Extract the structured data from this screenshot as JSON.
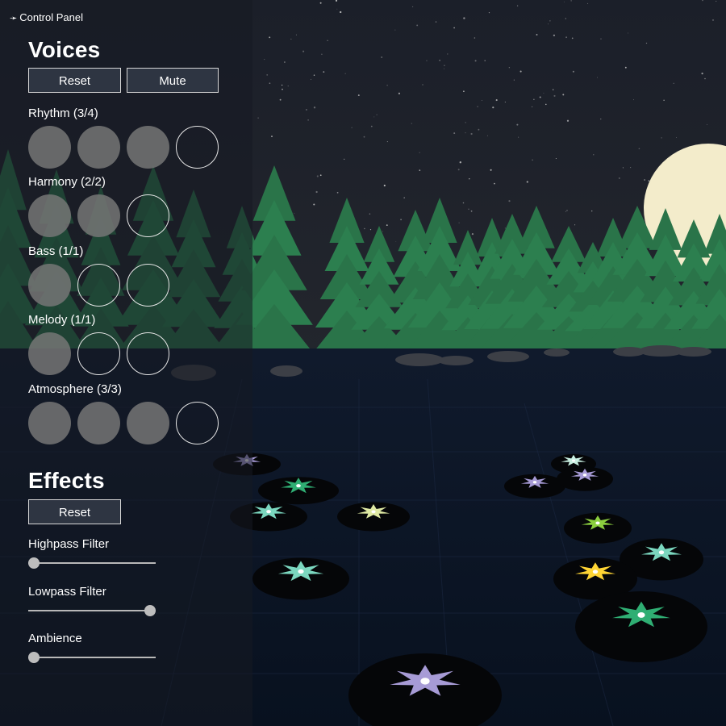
{
  "panel": {
    "toggle_label": "Control Panel",
    "toggle_icon": "arrow-right-icon"
  },
  "voices": {
    "title": "Voices",
    "reset_label": "Reset",
    "mute_label": "Mute",
    "groups": [
      {
        "label": "Rhythm (3/4)",
        "total": 4,
        "active": [
          true,
          true,
          true,
          false
        ]
      },
      {
        "label": "Harmony (2/2)",
        "total": 3,
        "active": [
          true,
          true,
          false
        ]
      },
      {
        "label": "Bass (1/1)",
        "total": 3,
        "active": [
          true,
          false,
          false
        ]
      },
      {
        "label": "Melody (1/1)",
        "total": 3,
        "active": [
          true,
          false,
          false
        ]
      },
      {
        "label": "Atmosphere (3/3)",
        "total": 4,
        "active": [
          true,
          true,
          true,
          false
        ]
      }
    ]
  },
  "effects": {
    "title": "Effects",
    "reset_label": "Reset",
    "sliders": [
      {
        "label": "Highpass Filter",
        "value": 0.0
      },
      {
        "label": "Lowpass Filter",
        "value": 1.0
      },
      {
        "label": "Ambience",
        "value": 0.0
      }
    ]
  },
  "colors": {
    "sky": "#1a1e28",
    "water": "#0b1424",
    "moon": "#f3eccb",
    "tree": "#2a7a4c",
    "lily_colors": [
      "#a79bd6",
      "#2fae73",
      "#7bd7bf",
      "#dfe9a3",
      "#ffd534",
      "#8bcf3f",
      "#c9f0e2"
    ]
  }
}
